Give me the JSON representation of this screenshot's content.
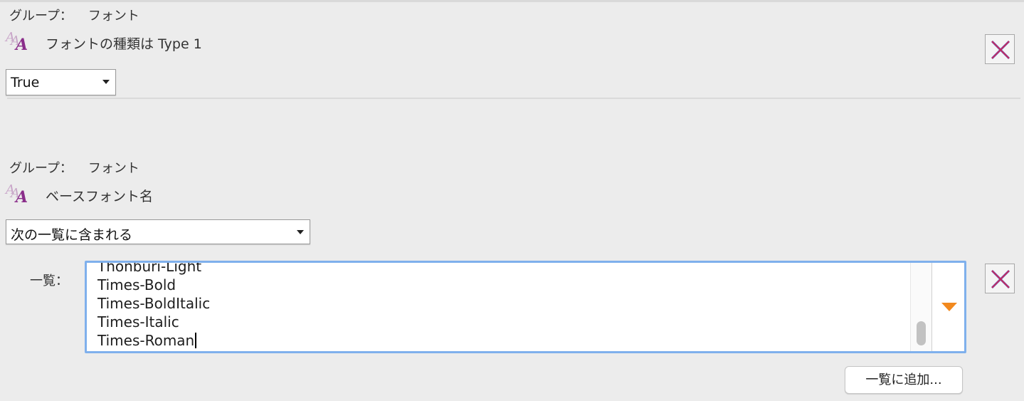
{
  "rule1": {
    "group_label": "グループ：",
    "group_value": "フォント",
    "icon": "font-size-icon",
    "condition": "フォントの種類は Type 1",
    "select_value": "True",
    "remove_icon": "close-x-icon"
  },
  "rule2": {
    "group_label": "グループ：",
    "group_value": "フォント",
    "icon": "font-size-icon",
    "condition": "ベースフォント名",
    "select_value": "次の一覧に含まれる",
    "list_label": "一覧：",
    "list_items": [
      "Thonburi-Light",
      "Times-Bold",
      "Times-BoldItalic",
      "Times-Italic",
      "Times-Roman"
    ],
    "list_menu_icon": "triangle-down-icon",
    "add_button": "一覧に追加...",
    "remove_icon": "close-x-icon"
  },
  "colors": {
    "focus_ring": "#7fb0ec",
    "menu_triangle": "#f2891e",
    "x_mark": "#b8306a",
    "icon_purple": "#8a2d8a"
  }
}
